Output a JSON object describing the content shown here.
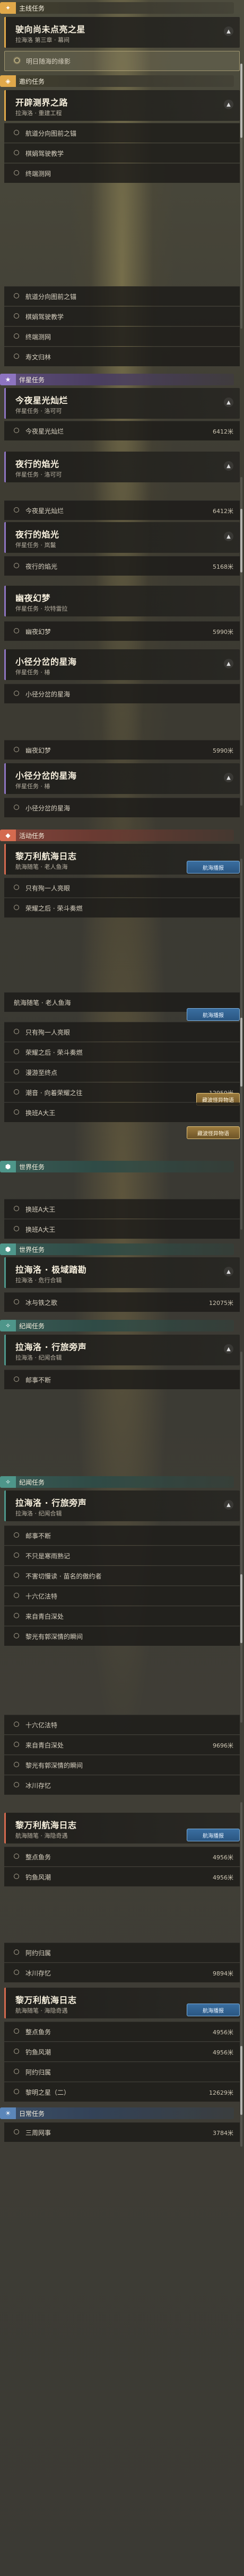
{
  "sections": {
    "main": "主线任务",
    "story": "邀约任务",
    "companion": "伴星任务",
    "event": "活动任务",
    "world": "世界任务",
    "world2": "纪闻任务",
    "daily": "日常任务"
  },
  "icons": {
    "main": "main-quest-icon",
    "story": "invite-quest-icon",
    "companion": "companion-quest-icon",
    "event": "event-quest-icon",
    "world": "world-quest-icon",
    "daily": "daily-quest-icon"
  },
  "quests": [
    {
      "title": "驶向尚未点亮之星",
      "sub": "拉海洛 第三章 · 幕间"
    },
    {
      "title": "开辟测界之路",
      "sub": "拉海洛 · 重建工程"
    },
    {
      "title": "今夜星光灿烂",
      "sub": "伴星任务 · 洛可可"
    },
    {
      "title": "夜行的焰光",
      "sub": "伴星任务 · 岚鬣"
    },
    {
      "title": "幽夜幻梦",
      "sub": "伴星任务 · 坎特雷拉"
    },
    {
      "title": "小径分岔的星海",
      "sub": "伴星任务 · 椿"
    },
    {
      "title": "黎万利航海日志",
      "sub": "航海随笔 · 老人鱼海"
    },
    {
      "title": "拉海洛 · 极域踏勘",
      "sub": "拉海洛 · 危行合辑"
    },
    {
      "title": "拉海洛 · 行旅旁声",
      "sub": "拉海洛 · 纪闻合辑"
    },
    {
      "title": "黎万利航海日志",
      "sub": "航海随笔 · 海隐奇遇"
    }
  ],
  "steps": [
    {
      "text": "明日随海的缘影",
      "dist": ""
    },
    {
      "text": "航道分向图前之锚",
      "dist": ""
    },
    {
      "text": "棋娟驾驶教学",
      "dist": ""
    },
    {
      "text": "终端测网",
      "dist": ""
    },
    {
      "text": "寿文归林",
      "dist": ""
    },
    {
      "text": "伴星任务 · 洛可可",
      "dist": ""
    },
    {
      "text": "今夜星光灿烂",
      "dist": "6412米"
    },
    {
      "text": "夜行的焰光",
      "dist": "5168米"
    },
    {
      "text": "幽夜幻梦",
      "dist": "5990米"
    },
    {
      "text": "小径分岔的星海",
      "dist": ""
    },
    {
      "text": "只有殉一人亮眼",
      "dist": ""
    },
    {
      "text": "荣耀之后 · 荣斗奏燃",
      "dist": ""
    },
    {
      "text": "漫游至终点",
      "dist": ""
    },
    {
      "text": "潮音 · 向着荣耀之往",
      "dist": "12959米"
    },
    {
      "text": "换班A大王",
      "dist": ""
    },
    {
      "text": "冰与铁之歌",
      "dist": "12075米"
    },
    {
      "text": "潮音 · 行旅旁声",
      "dist": ""
    },
    {
      "text": "邮事不断",
      "dist": ""
    },
    {
      "text": "不只是寒雨熟记",
      "dist": ""
    },
    {
      "text": "不害切慢读 · 苗名的傲约者",
      "dist": ""
    },
    {
      "text": "十六亿法特",
      "dist": ""
    },
    {
      "text": "来自青白深处",
      "dist": ""
    },
    {
      "text": "黎光有郭深情的瞬间",
      "dist": ""
    },
    {
      "text": "冰川存忆",
      "dist": ""
    },
    {
      "text": "整点鱼务",
      "dist": ""
    },
    {
      "text": "钓鱼风潮",
      "dist": ""
    },
    {
      "text": "阿约归属",
      "dist": ""
    },
    {
      "text": "黎明之星（二）",
      "dist": "12629米"
    },
    {
      "text": "三周网事",
      "dist": "3784米"
    },
    {
      "text": "9696米",
      "dist": ""
    },
    {
      "text": "9894米",
      "dist": ""
    },
    {
      "text": "4956米",
      "dist": ""
    },
    {
      "text": "3939米",
      "dist": ""
    }
  ],
  "pills": {
    "track": "航海播报",
    "gold": "藏波怪异物语"
  },
  "trackers": {
    "a": "黎万利航海日志"
  }
}
